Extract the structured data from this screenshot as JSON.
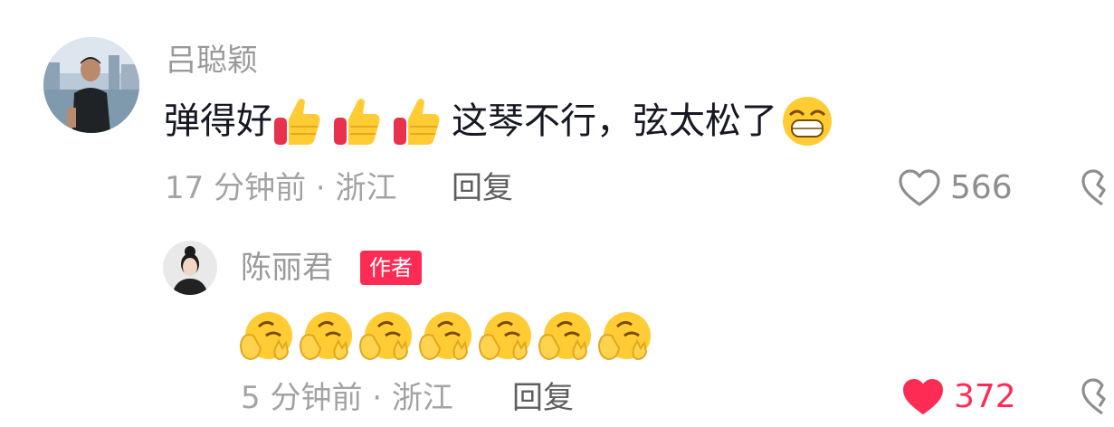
{
  "colors": {
    "accent": "#fe2c55",
    "username": "#9a9a9a",
    "meta": "#a3a3a3",
    "text": "#161823"
  },
  "comment": {
    "username": "吕聪颖",
    "text_before": "弹得好",
    "text_after": "这琴不行，弦太松了",
    "emojis": [
      "thumbs-up-emoji",
      "thumbs-up-emoji",
      "thumbs-up-emoji",
      "grinning-emoji"
    ],
    "meta": "17 分钟前 · 浙江",
    "reply_label": "回复",
    "likes": "566",
    "liked": false
  },
  "reply": {
    "username": "陈丽君",
    "badge": "作者",
    "emojis": [
      "facepalm-emoji",
      "facepalm-emoji",
      "facepalm-emoji",
      "facepalm-emoji",
      "facepalm-emoji",
      "facepalm-emoji",
      "facepalm-emoji"
    ],
    "meta": "5 分钟前 · 浙江",
    "reply_label": "回复",
    "likes": "372",
    "liked": true
  }
}
